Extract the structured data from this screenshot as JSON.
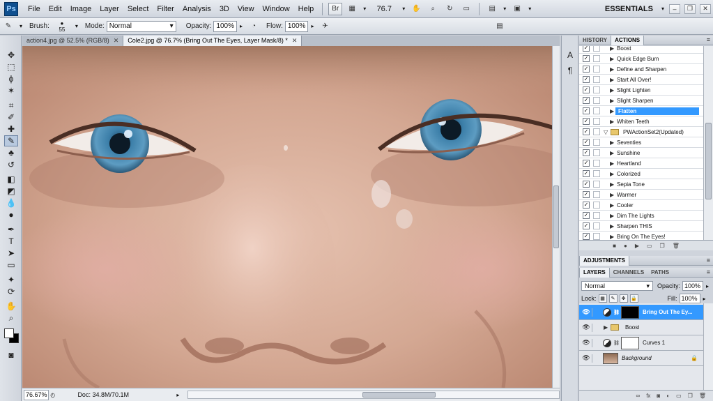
{
  "menubar": {
    "logo": "Ps",
    "items": [
      "File",
      "Edit",
      "Image",
      "Layer",
      "Select",
      "Filter",
      "Analysis",
      "3D",
      "View",
      "Window",
      "Help"
    ],
    "zoom": "76.7",
    "workspace": "ESSENTIALS"
  },
  "options": {
    "brush_label": "Brush:",
    "brush_size": "55",
    "mode_label": "Mode:",
    "mode_value": "Normal",
    "opacity_label": "Opacity:",
    "opacity_value": "100%",
    "flow_label": "Flow:",
    "flow_value": "100%"
  },
  "documents": {
    "tabs": [
      {
        "label": "action4.jpg @ 52.5% (RGB/8)",
        "active": false
      },
      {
        "label": "Cole2.jpg @ 76.7% (Bring Out The Eyes, Layer Mask/8) *",
        "active": true
      }
    ]
  },
  "status": {
    "zoom": "76.67%",
    "doc_size": "Doc: 34.8M/70.1M"
  },
  "history_panel": {
    "tabs": [
      "HISTORY",
      "ACTIONS"
    ],
    "active_tab": "ACTIONS",
    "rows": [
      {
        "label": "Boost",
        "type": "action"
      },
      {
        "label": "Quick Edge Burn",
        "type": "action"
      },
      {
        "label": "Define and Sharpen",
        "type": "action"
      },
      {
        "label": "Start All Over!",
        "type": "action"
      },
      {
        "label": "Slight Lighten",
        "type": "action"
      },
      {
        "label": "Slight Sharpen",
        "type": "action"
      },
      {
        "label": "Flatten",
        "type": "action",
        "selected": true
      },
      {
        "label": "Whiten Teeth",
        "type": "action"
      },
      {
        "label": "PWActionSet2(Updated)",
        "type": "set"
      },
      {
        "label": "Seventies",
        "type": "action"
      },
      {
        "label": "Sunshine",
        "type": "action"
      },
      {
        "label": "Heartland",
        "type": "action"
      },
      {
        "label": "Colorized",
        "type": "action"
      },
      {
        "label": "Sepia Tone",
        "type": "action"
      },
      {
        "label": "Warmer",
        "type": "action"
      },
      {
        "label": "Cooler",
        "type": "action"
      },
      {
        "label": "Dim The Lights",
        "type": "action"
      },
      {
        "label": "Sharpen THIS",
        "type": "action"
      },
      {
        "label": "Bring On The Eyes!",
        "type": "action"
      }
    ]
  },
  "adjustments_panel": {
    "title": "ADJUSTMENTS"
  },
  "layers_panel": {
    "tabs": [
      "LAYERS",
      "CHANNELS",
      "PATHS"
    ],
    "active_tab": "LAYERS",
    "blend_mode": "Normal",
    "opacity_label": "Opacity:",
    "opacity_value": "100%",
    "lock_label": "Lock:",
    "fill_label": "Fill:",
    "fill_value": "100%",
    "layers": [
      {
        "name": "Bring Out The Ey...",
        "kind": "adjustment-mask-black",
        "selected": true
      },
      {
        "name": "Boost",
        "kind": "group"
      },
      {
        "name": "Curves 1",
        "kind": "adjustment-mask-white"
      },
      {
        "name": "Background",
        "kind": "image",
        "locked": true
      }
    ]
  },
  "colors": {
    "selection": "#3399ff",
    "panel_bg": "#cfd4dc",
    "skin": "#d2a48b",
    "iris": "#3e7fa8"
  },
  "icons": {
    "tools": [
      "move-icon",
      "marquee-icon",
      "lasso-icon",
      "magic-wand-icon",
      "crop-icon",
      "eyedropper-icon",
      "healing-brush-icon",
      "brush-icon",
      "clone-stamp-icon",
      "history-brush-icon",
      "eraser-icon",
      "paint-bucket-icon",
      "blur-icon",
      "dodge-icon",
      "pen-icon",
      "type-icon",
      "path-selection-icon",
      "shape-icon",
      "3d-rotate-icon",
      "3d-orbit-icon",
      "hand-icon",
      "zoom-icon"
    ]
  }
}
